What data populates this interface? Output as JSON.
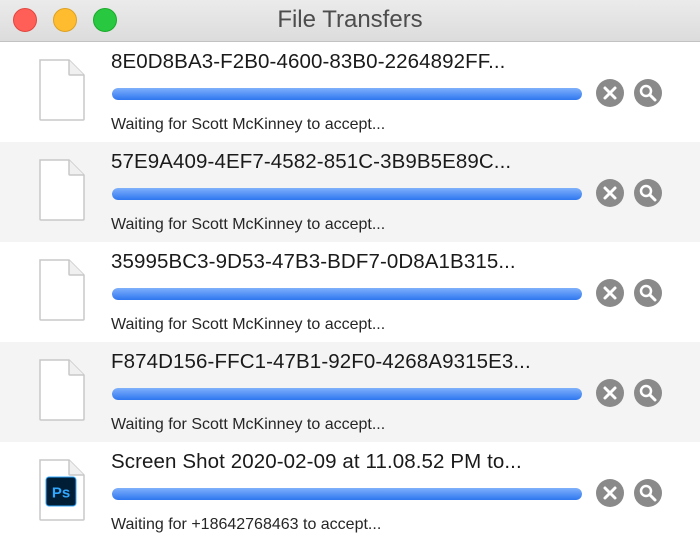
{
  "window": {
    "title": "File Transfers"
  },
  "transfers": [
    {
      "filename": "8E0D8BA3-F2B0-4600-83B0-2264892FF...",
      "status": "Waiting for Scott McKinney to accept...",
      "file_icon": "blank-document-icon",
      "progress": 1.0
    },
    {
      "filename": "57E9A409-4EF7-4582-851C-3B9B5E89C...",
      "status": "Waiting for Scott McKinney to accept...",
      "file_icon": "blank-document-icon",
      "progress": 1.0
    },
    {
      "filename": "35995BC3-9D53-47B3-BDF7-0D8A1B315...",
      "status": "Waiting for Scott McKinney to accept...",
      "file_icon": "blank-document-icon",
      "progress": 1.0
    },
    {
      "filename": "F874D156-FFC1-47B1-92F0-4268A9315E3...",
      "status": "Waiting for Scott McKinney to accept...",
      "file_icon": "blank-document-icon",
      "progress": 1.0
    },
    {
      "filename": "Screen Shot 2020-02-09 at 11.08.52 PM to...",
      "status": "Waiting for +18642768463 to accept...",
      "file_icon": "photoshop-document-icon",
      "badge_text": "Ps",
      "progress": 1.0
    }
  ],
  "icons": {
    "cancel": "cancel-icon",
    "reveal": "magnifying-glass-icon"
  },
  "colors": {
    "progress": "#3b82f6",
    "button": "#8a8a8a",
    "row_alt": "#f4f4f4",
    "photoshop_badge": "#001e36",
    "photoshop_text": "#31a8ff"
  }
}
